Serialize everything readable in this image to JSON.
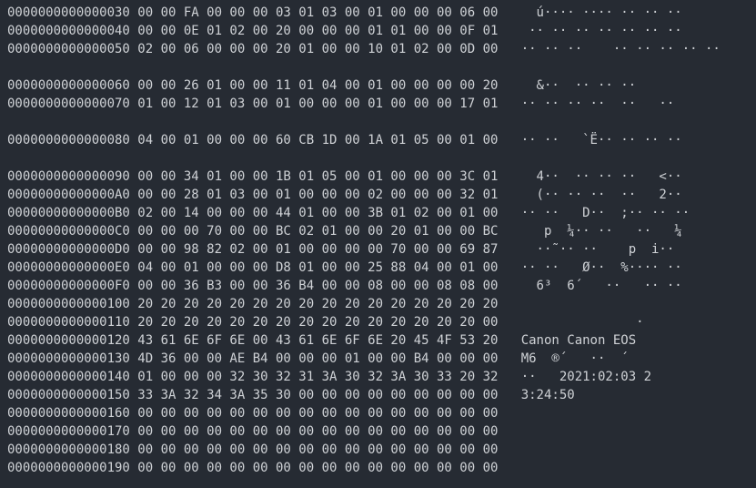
{
  "rows": [
    {
      "offset": "0000000000000030",
      "hex": "00 00 FA 00 00 00 03 01 03 00 01 00 00 00 06 00",
      "ascii": "  ú···· ···· ·· ·· ··"
    },
    {
      "offset": "0000000000000040",
      "hex": "00 00 0E 01 02 00 20 00 00 00 01 01 00 00 0F 01",
      "ascii": " ·· ·· ·· ·· ·· ·· ··"
    },
    {
      "offset": "0000000000000050",
      "hex": "02 00 06 00 00 00 20 01 00 00 10 01 02 00 0D 00",
      "ascii": "·· ·· ··    ·· ·· ·· ·· ··"
    },
    {
      "blank": true
    },
    {
      "offset": "0000000000000060",
      "hex": "00 00 26 01 00 00 11 01 04 00 01 00 00 00 00 20",
      "ascii": "  &··  ·· ·· ··     "
    },
    {
      "offset": "0000000000000070",
      "hex": "01 00 12 01 03 00 01 00 00 00 01 00 00 00 17 01",
      "ascii": "·· ·· ·· ··  ··   ··"
    },
    {
      "blank": true
    },
    {
      "offset": "0000000000000080",
      "hex": "04 00 01 00 00 00 60 CB 1D 00 1A 01 05 00 01 00",
      "ascii": "·· ··   `Ë·· ·· ·· ··"
    },
    {
      "blank": true
    },
    {
      "offset": "0000000000000090",
      "hex": "00 00 34 01 00 00 1B 01 05 00 01 00 00 00 3C 01",
      "ascii": "  4··  ·· ·· ··   <··"
    },
    {
      "offset": "00000000000000A0",
      "hex": "00 00 28 01 03 00 01 00 00 00 02 00 00 00 32 01",
      "ascii": "  (·· ·· ··  ··   2··"
    },
    {
      "offset": "00000000000000B0",
      "hex": "02 00 14 00 00 00 44 01 00 00 3B 01 02 00 01 00",
      "ascii": "·· ··   D··  ;·· ·· ··"
    },
    {
      "offset": "00000000000000C0",
      "hex": "00 00 00 70 00 00 BC 02 01 00 00 20 01 00 00 BC",
      "ascii": "   p  ¼·· ··   ··   ¼"
    },
    {
      "offset": "00000000000000D0",
      "hex": "00 00 98 82 02 00 01 00 00 00 00 70 00 00 69 87",
      "ascii": "  ··˜·· ··    p  i··"
    },
    {
      "offset": "00000000000000E0",
      "hex": "04 00 01 00 00 00 D8 01 00 00 25 88 04 00 01 00",
      "ascii": "·· ··   Ø··  %···· ··"
    },
    {
      "offset": "00000000000000F0",
      "hex": "00 00 36 B3 00 00 36 B4 00 00 08 00 00 08 08 00",
      "ascii": "  6³  6´   ··   ·· ·· "
    },
    {
      "offset": "0000000000000100",
      "hex": "20 20 20 20 20 20 20 20 20 20 20 20 20 20 20 20",
      "ascii": "                "
    },
    {
      "offset": "0000000000000110",
      "hex": "20 20 20 20 20 20 20 20 20 20 20 20 20 20 20 00",
      "ascii": "               ·"
    },
    {
      "offset": "0000000000000120",
      "hex": "43 61 6E 6F 6E 00 43 61 6E 6F 6E 20 45 4F 53 20",
      "ascii": "Canon Canon EOS "
    },
    {
      "offset": "0000000000000130",
      "hex": "4D 36 00 00 AE B4 00 00 00 01 00 00 B4 00 00 00",
      "ascii": "M6  ®´   ··  ´   "
    },
    {
      "offset": "0000000000000140",
      "hex": "01 00 00 00 32 30 32 31 3A 30 32 3A 30 33 20 32",
      "ascii": "··   2021:02:03 2"
    },
    {
      "offset": "0000000000000150",
      "hex": "33 3A 32 34 3A 35 30 00 00 00 00 00 00 00 00 00",
      "ascii": "3:24:50         "
    },
    {
      "offset": "0000000000000160",
      "hex": "00 00 00 00 00 00 00 00 00 00 00 00 00 00 00 00",
      "ascii": "                "
    },
    {
      "offset": "0000000000000170",
      "hex": "00 00 00 00 00 00 00 00 00 00 00 00 00 00 00 00",
      "ascii": "                "
    },
    {
      "offset": "0000000000000180",
      "hex": "00 00 00 00 00 00 00 00 00 00 00 00 00 00 00 00",
      "ascii": "                "
    },
    {
      "offset": "0000000000000190",
      "hex": "00 00 00 00 00 00 00 00 00 00 00 00 00 00 00 00",
      "ascii": "                "
    }
  ]
}
